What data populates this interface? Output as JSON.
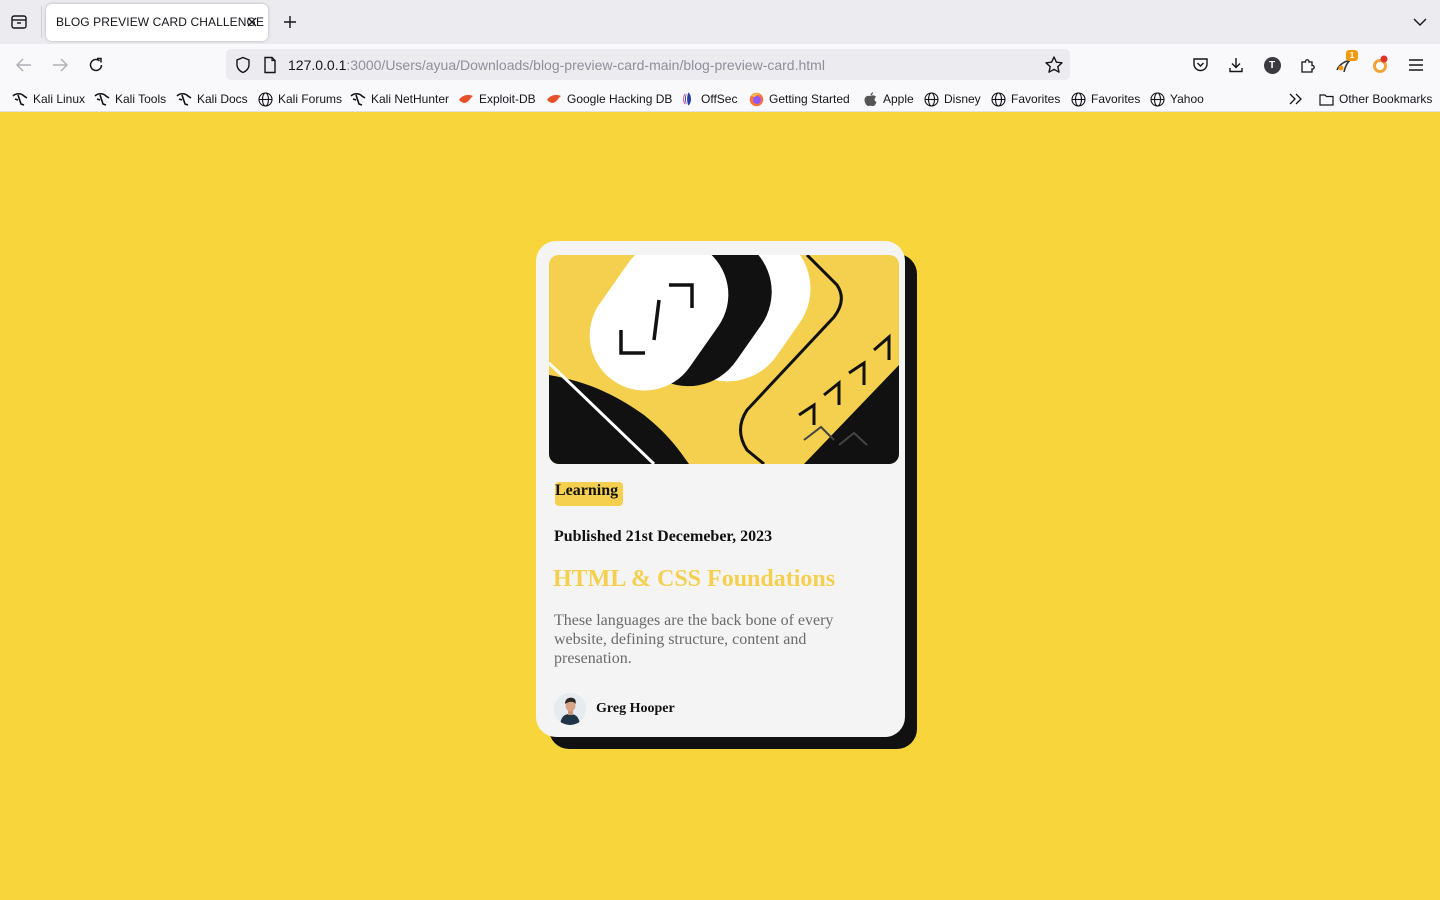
{
  "browser": {
    "tab_title": "BLOG PREVIEW CARD CHALLENGE",
    "url_host": "127.0.0.1",
    "url_path": ":3000/Users/ayua/Downloads/blog-preview-card-main/blog-preview-card.html",
    "extension_badge": "1",
    "account_initial": "T"
  },
  "bookmarks": {
    "items": [
      {
        "label": "Kali Linux",
        "icon": "kali-dragon-icon"
      },
      {
        "label": "Kali Tools",
        "icon": "kali-dragon-icon"
      },
      {
        "label": "Kali Docs",
        "icon": "kali-dragon-icon"
      },
      {
        "label": "Kali Forums",
        "icon": "globe-icon"
      },
      {
        "label": "Kali NetHunter",
        "icon": "kali-dragon-icon"
      },
      {
        "label": "Exploit-DB",
        "icon": "exploit-db-icon"
      },
      {
        "label": "Google Hacking DB",
        "icon": "exploit-db-icon"
      },
      {
        "label": "OffSec",
        "icon": "offsec-icon"
      },
      {
        "label": "Getting Started",
        "icon": "firefox-icon"
      },
      {
        "label": "Apple",
        "icon": "apple-icon"
      },
      {
        "label": "Disney",
        "icon": "globe-icon"
      },
      {
        "label": "Favorites",
        "icon": "globe-icon"
      },
      {
        "label": "Favorites",
        "icon": "globe-icon"
      },
      {
        "label": "Yahoo",
        "icon": "globe-icon"
      }
    ],
    "other_label": "Other Bookmarks"
  },
  "card": {
    "tag": "Learning",
    "published": "Published 21st Decemeber, 2023",
    "title": "HTML & CSS Foundations",
    "description": "These languages are the back bone of every website, defining structure, content and presenation.",
    "author": "Greg Hooper"
  },
  "colors": {
    "page_background": "#f8d53b",
    "accent_yellow": "#f4d04e",
    "card_background": "#f4f4f5",
    "shadow_black": "#111111"
  }
}
